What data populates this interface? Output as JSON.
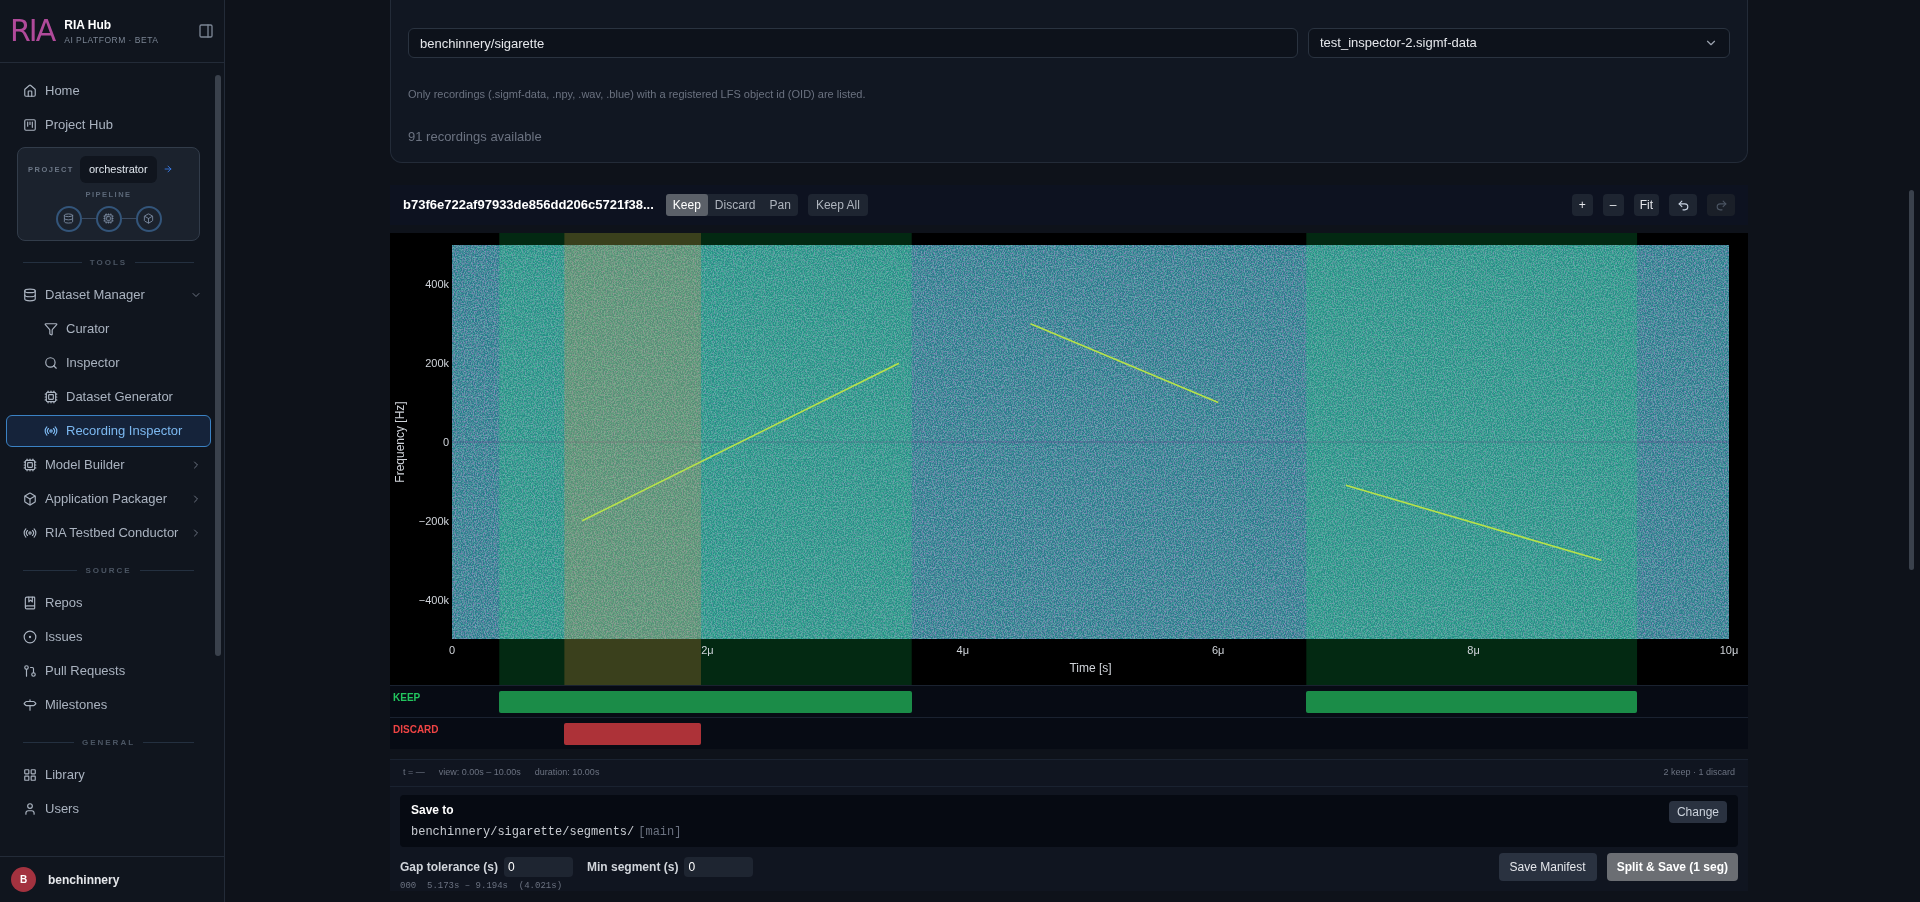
{
  "sidebar": {
    "logo_text": "RIA",
    "title": "RIA Hub",
    "subtitle": "AI PLATFORM · BETA",
    "top_items": [
      {
        "label": "Home",
        "selected": false
      },
      {
        "label": "Project Hub",
        "selected": false
      }
    ],
    "project": {
      "label": "PROJECT",
      "name": "orchestrator",
      "pipeline_label": "PIPELINE"
    },
    "sections": [
      {
        "title": "TOOLS",
        "items": [
          {
            "label": "Dataset Manager",
            "selected": false,
            "expanded": true,
            "children": [
              {
                "label": "Curator",
                "selected": false
              },
              {
                "label": "Inspector",
                "selected": false
              },
              {
                "label": "Dataset Generator",
                "selected": false
              },
              {
                "label": "Recording Inspector",
                "selected": true
              }
            ]
          },
          {
            "label": "Model Builder",
            "selected": false,
            "expanded": false
          },
          {
            "label": "Application Packager",
            "selected": false,
            "expanded": false
          },
          {
            "label": "RIA Testbed Conductor",
            "selected": false,
            "expanded": false
          }
        ]
      },
      {
        "title": "SOURCE",
        "items": [
          {
            "label": "Repos",
            "selected": false
          },
          {
            "label": "Issues",
            "selected": false
          },
          {
            "label": "Pull Requests",
            "selected": false
          },
          {
            "label": "Milestones",
            "selected": false
          }
        ]
      },
      {
        "title": "GENERAL",
        "items": [
          {
            "label": "Library",
            "selected": false
          },
          {
            "label": "Users",
            "selected": false
          }
        ]
      }
    ],
    "user": {
      "initial": "B",
      "name": "benchinnery"
    }
  },
  "picker": {
    "repo_value": "benchinnery/sigarette",
    "recording_value": "test_inspector-2.sigmf-data",
    "note": "Only recordings (.sigmf-data, .npy, .wav, .blue) with a registered LFS object id (OID) are listed.",
    "count": "91 recordings available"
  },
  "inspector": {
    "file_name": "b73f6e722af97933de856dd206c5721f38...",
    "modes": [
      {
        "label": "Keep",
        "selected": true
      },
      {
        "label": "Discard",
        "selected": false
      },
      {
        "label": "Pan",
        "selected": false
      }
    ],
    "keep_all": "Keep All",
    "zoom_buttons": [
      "+",
      "–",
      "Fit"
    ],
    "icon_buttons": [
      {
        "disabled": false
      },
      {
        "disabled": true
      }
    ],
    "spectrogram": {
      "y_axis_title": "Frequency [Hz]",
      "x_axis_title": "Time [s]",
      "y_tick_labels": [
        "400k",
        "200k",
        "0",
        "−200k",
        "−400k"
      ],
      "x_tick_labels": [
        "0",
        "2μ",
        "4μ",
        "6μ",
        "8μ",
        "10μ"
      ]
    },
    "tracks": [
      {
        "label": "KEEP",
        "kind": "keep"
      },
      {
        "label": "DISCARD",
        "kind": "discard"
      }
    ],
    "status": {
      "cursor": "t = —",
      "view": "view: 0.00s – 10.00s",
      "duration": "duration: 10.00s",
      "summary": "2 keep · 1 discard"
    },
    "save": {
      "title": "Save to",
      "path": "benchinnery/sigarette/segments/",
      "branch": "[main]",
      "change": "Change"
    },
    "gap_label": "Gap tolerance (s)",
    "gap_value": "0",
    "min_label": "Min segment (s)",
    "min_value": "0",
    "save_manifest": "Save Manifest",
    "split_save": "Split & Save (1 seg)",
    "selection_readout": "000  5.173s – 9.194s  (4.021s)"
  }
}
